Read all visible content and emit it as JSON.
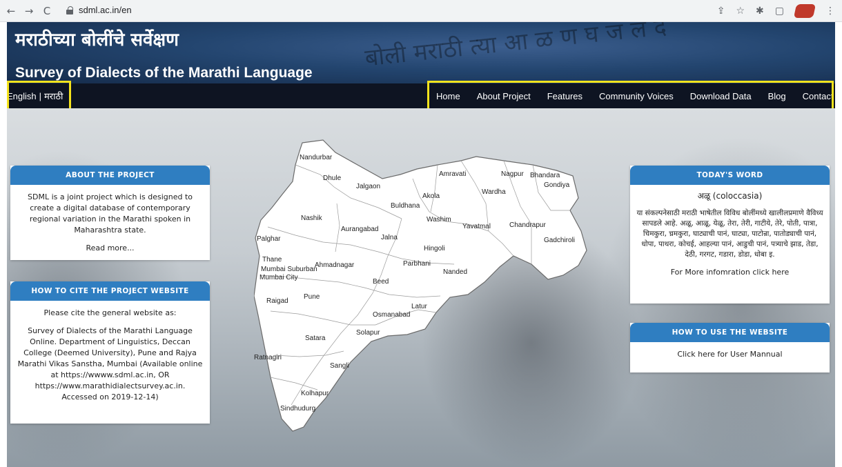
{
  "browser": {
    "url": "sdml.ac.in/en",
    "back_icon": "←",
    "forward_icon": "→",
    "reload_icon": "C"
  },
  "header": {
    "title_marathi": "मराठीच्या बोलींचे सर्वेक्षण",
    "title_english": "Survey of Dialects of the Marathi Language",
    "background_script": "बोली मराठी त्या  आ  ळ  ण  घ  ज  ल  द"
  },
  "language_switcher": {
    "english": "English",
    "separator": "|",
    "marathi": "मराठी"
  },
  "nav": {
    "items": [
      "Home",
      "About Project",
      "Features",
      "Community Voices",
      "Download Data",
      "Blog",
      "Contact Us"
    ]
  },
  "about_card": {
    "title": "ABOUT THE PROJECT",
    "body": "SDML is a joint project which is designed to create a digital database of contemporary regional variation in the Marathi spoken in Maharashtra state.",
    "link": "Read more..."
  },
  "cite_card": {
    "title": "HOW TO CITE THE PROJECT WEBSITE",
    "intro": "Please cite the general website as:",
    "citation": "Survey of Dialects of the Marathi Language Online. Department of Linguistics, Deccan College (Deemed University), Pune and Rajya Marathi Vikas Sanstha, Mumbai (Available online at https://wwww.sdml.ac.in, OR https://www.marathidialectsurvey.ac.in. Accessed on 2019-12-14)"
  },
  "word_card": {
    "title": "TODAY'S WORD",
    "word": "अळू (coloccasia)",
    "description": "या संकल्पनेसाठी मराठी भाषेतील विविध बोलींमध्ये खालीलप्रमाणे वैविध्य सापडले आहे. अळू, आळू, येळू, तेरा, तेरी, गाटीये, तेरे, पोती, पात्रा, चिमकुरा, च्रमकुरा, घाट्याची पानं, घाट्या, पाटोन्रा, पातोड्याची पानं, धोपा, पाथरा, कोचई, आहल्या पानं, आडुची पानं, पत्र्याचे झाड, तेडा, देठी, गरगट, गडारा, डोडा, धोबा इ.",
    "link": "For More infomration click here"
  },
  "howto_card": {
    "title": "HOW TO USE THE WEBSITE",
    "link": "Click here for User Mannual"
  },
  "map": {
    "districts": [
      "Nandurbar",
      "Dhule",
      "Jalgaon",
      "Amravati",
      "Nagpur",
      "Bhandara",
      "Gondiya",
      "Akola",
      "Wardha",
      "Buldhana",
      "Nashik",
      "Washim",
      "Yavatmal",
      "Chandrapur",
      "Gadchiroli",
      "Aurangabad",
      "Jalna",
      "Hingoli",
      "Palghar",
      "Thane",
      "Mumbai Suburban",
      "Mumbai City",
      "Ahmadnagar",
      "Parbhani",
      "Nanded",
      "Beed",
      "Raigad",
      "Pune",
      "Latur",
      "Osmanabad",
      "Solapur",
      "Satara",
      "Ratnagiri",
      "Sangli",
      "Kolhapur",
      "Sindhudurg"
    ]
  },
  "colors": {
    "accent": "#2f7ec1",
    "header_bg": "#23456f",
    "nav_bg": "#0e1422",
    "highlight": "#f5e31c"
  }
}
